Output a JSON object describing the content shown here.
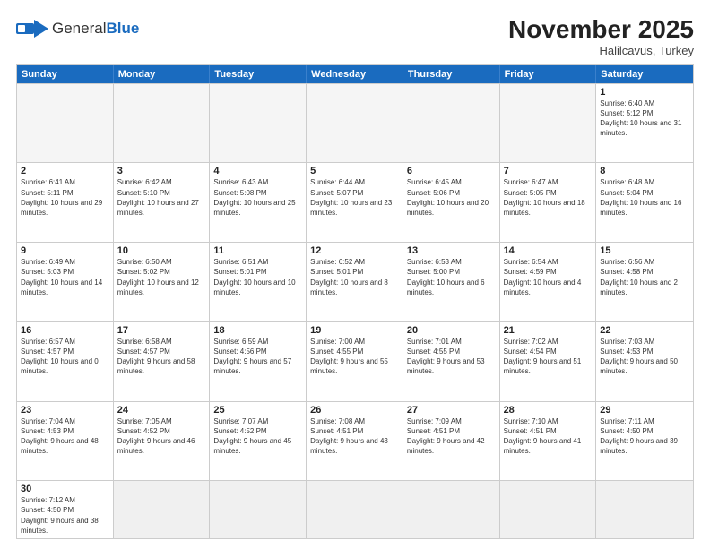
{
  "header": {
    "logo_general": "General",
    "logo_blue": "Blue",
    "month_title": "November 2025",
    "location": "Halilcavus, Turkey"
  },
  "weekdays": [
    "Sunday",
    "Monday",
    "Tuesday",
    "Wednesday",
    "Thursday",
    "Friday",
    "Saturday"
  ],
  "rows": [
    [
      {
        "day": "",
        "info": ""
      },
      {
        "day": "",
        "info": ""
      },
      {
        "day": "",
        "info": ""
      },
      {
        "day": "",
        "info": ""
      },
      {
        "day": "",
        "info": ""
      },
      {
        "day": "",
        "info": ""
      },
      {
        "day": "1",
        "info": "Sunrise: 6:40 AM\nSunset: 5:12 PM\nDaylight: 10 hours and 31 minutes."
      }
    ],
    [
      {
        "day": "2",
        "info": "Sunrise: 6:41 AM\nSunset: 5:11 PM\nDaylight: 10 hours and 29 minutes."
      },
      {
        "day": "3",
        "info": "Sunrise: 6:42 AM\nSunset: 5:10 PM\nDaylight: 10 hours and 27 minutes."
      },
      {
        "day": "4",
        "info": "Sunrise: 6:43 AM\nSunset: 5:08 PM\nDaylight: 10 hours and 25 minutes."
      },
      {
        "day": "5",
        "info": "Sunrise: 6:44 AM\nSunset: 5:07 PM\nDaylight: 10 hours and 23 minutes."
      },
      {
        "day": "6",
        "info": "Sunrise: 6:45 AM\nSunset: 5:06 PM\nDaylight: 10 hours and 20 minutes."
      },
      {
        "day": "7",
        "info": "Sunrise: 6:47 AM\nSunset: 5:05 PM\nDaylight: 10 hours and 18 minutes."
      },
      {
        "day": "8",
        "info": "Sunrise: 6:48 AM\nSunset: 5:04 PM\nDaylight: 10 hours and 16 minutes."
      }
    ],
    [
      {
        "day": "9",
        "info": "Sunrise: 6:49 AM\nSunset: 5:03 PM\nDaylight: 10 hours and 14 minutes."
      },
      {
        "day": "10",
        "info": "Sunrise: 6:50 AM\nSunset: 5:02 PM\nDaylight: 10 hours and 12 minutes."
      },
      {
        "day": "11",
        "info": "Sunrise: 6:51 AM\nSunset: 5:01 PM\nDaylight: 10 hours and 10 minutes."
      },
      {
        "day": "12",
        "info": "Sunrise: 6:52 AM\nSunset: 5:01 PM\nDaylight: 10 hours and 8 minutes."
      },
      {
        "day": "13",
        "info": "Sunrise: 6:53 AM\nSunset: 5:00 PM\nDaylight: 10 hours and 6 minutes."
      },
      {
        "day": "14",
        "info": "Sunrise: 6:54 AM\nSunset: 4:59 PM\nDaylight: 10 hours and 4 minutes."
      },
      {
        "day": "15",
        "info": "Sunrise: 6:56 AM\nSunset: 4:58 PM\nDaylight: 10 hours and 2 minutes."
      }
    ],
    [
      {
        "day": "16",
        "info": "Sunrise: 6:57 AM\nSunset: 4:57 PM\nDaylight: 10 hours and 0 minutes."
      },
      {
        "day": "17",
        "info": "Sunrise: 6:58 AM\nSunset: 4:57 PM\nDaylight: 9 hours and 58 minutes."
      },
      {
        "day": "18",
        "info": "Sunrise: 6:59 AM\nSunset: 4:56 PM\nDaylight: 9 hours and 57 minutes."
      },
      {
        "day": "19",
        "info": "Sunrise: 7:00 AM\nSunset: 4:55 PM\nDaylight: 9 hours and 55 minutes."
      },
      {
        "day": "20",
        "info": "Sunrise: 7:01 AM\nSunset: 4:55 PM\nDaylight: 9 hours and 53 minutes."
      },
      {
        "day": "21",
        "info": "Sunrise: 7:02 AM\nSunset: 4:54 PM\nDaylight: 9 hours and 51 minutes."
      },
      {
        "day": "22",
        "info": "Sunrise: 7:03 AM\nSunset: 4:53 PM\nDaylight: 9 hours and 50 minutes."
      }
    ],
    [
      {
        "day": "23",
        "info": "Sunrise: 7:04 AM\nSunset: 4:53 PM\nDaylight: 9 hours and 48 minutes."
      },
      {
        "day": "24",
        "info": "Sunrise: 7:05 AM\nSunset: 4:52 PM\nDaylight: 9 hours and 46 minutes."
      },
      {
        "day": "25",
        "info": "Sunrise: 7:07 AM\nSunset: 4:52 PM\nDaylight: 9 hours and 45 minutes."
      },
      {
        "day": "26",
        "info": "Sunrise: 7:08 AM\nSunset: 4:51 PM\nDaylight: 9 hours and 43 minutes."
      },
      {
        "day": "27",
        "info": "Sunrise: 7:09 AM\nSunset: 4:51 PM\nDaylight: 9 hours and 42 minutes."
      },
      {
        "day": "28",
        "info": "Sunrise: 7:10 AM\nSunset: 4:51 PM\nDaylight: 9 hours and 41 minutes."
      },
      {
        "day": "29",
        "info": "Sunrise: 7:11 AM\nSunset: 4:50 PM\nDaylight: 9 hours and 39 minutes."
      }
    ],
    [
      {
        "day": "30",
        "info": "Sunrise: 7:12 AM\nSunset: 4:50 PM\nDaylight: 9 hours and 38 minutes."
      },
      {
        "day": "",
        "info": ""
      },
      {
        "day": "",
        "info": ""
      },
      {
        "day": "",
        "info": ""
      },
      {
        "day": "",
        "info": ""
      },
      {
        "day": "",
        "info": ""
      },
      {
        "day": "",
        "info": ""
      }
    ]
  ]
}
